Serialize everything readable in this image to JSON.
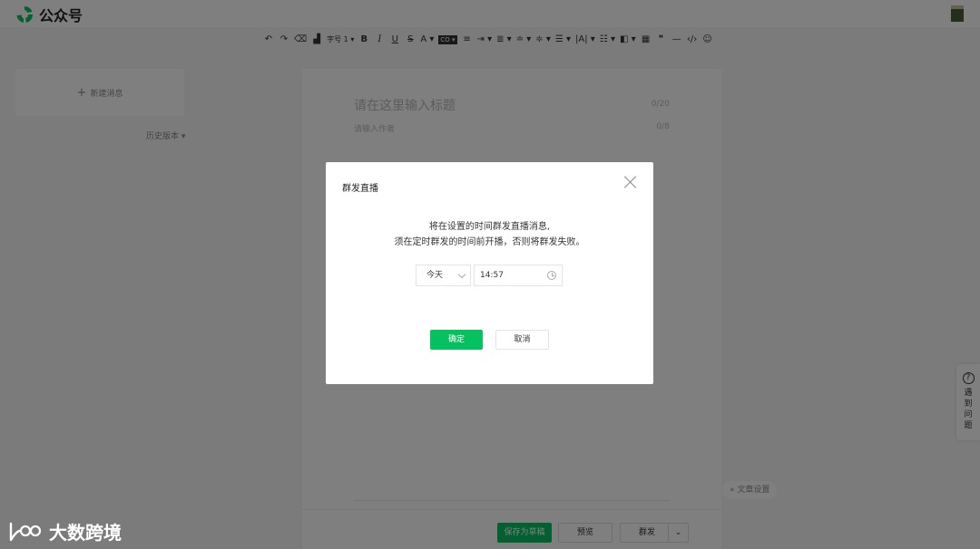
{
  "app": {
    "name": "公众号"
  },
  "toolbar": {
    "items": [
      {
        "name": "undo-icon",
        "glyph": "↶"
      },
      {
        "name": "redo-icon",
        "glyph": "↷"
      },
      {
        "name": "format-paint-icon",
        "glyph": "⌫"
      },
      {
        "name": "clear-format-icon",
        "glyph": "▟"
      },
      {
        "name": "font-size-select",
        "glyph": "字号 1 ▾"
      },
      {
        "name": "bold-button",
        "glyph": "B"
      },
      {
        "name": "italic-button",
        "glyph": "I"
      },
      {
        "name": "underline-button",
        "glyph": "U"
      },
      {
        "name": "strikethrough-button",
        "glyph": "S"
      },
      {
        "name": "font-color-button",
        "glyph": "A ▾"
      },
      {
        "name": "background-color-button",
        "glyph": "CO ▾"
      },
      {
        "name": "align-left-icon",
        "glyph": "≡"
      },
      {
        "name": "indent-icon",
        "glyph": "⇥ ▾"
      },
      {
        "name": "align-center-icon",
        "glyph": "≣ ▾"
      },
      {
        "name": "line-height-icon",
        "glyph": "≐ ▾"
      },
      {
        "name": "paragraph-spacing-icon",
        "glyph": "≑ ▾"
      },
      {
        "name": "list-icon",
        "glyph": "☰ ▾"
      },
      {
        "name": "letter-spacing-icon",
        "glyph": "|A| ▾"
      },
      {
        "name": "bullet-list-icon",
        "glyph": "☷ ▾"
      },
      {
        "name": "border-icon",
        "glyph": "◧ ▾"
      },
      {
        "name": "table-icon",
        "glyph": "▦"
      },
      {
        "name": "quote-icon",
        "glyph": "❞"
      },
      {
        "name": "divider-icon",
        "glyph": "—"
      },
      {
        "name": "code-icon",
        "glyph": "‹/›"
      },
      {
        "name": "emoji-icon",
        "glyph": "☺"
      }
    ]
  },
  "sidebar": {
    "new_message": "新建消息",
    "history": "历史版本 ▾"
  },
  "editor": {
    "title_placeholder": "请在这里输入标题",
    "title_count": "0/20",
    "author_placeholder": "请输入作者",
    "author_count": "0/8"
  },
  "article_settings": "文章设置",
  "help": {
    "label": "遇到问题"
  },
  "bottom": {
    "save": "保存为草稿",
    "preview": "预览",
    "send": "群发"
  },
  "dialog": {
    "title": "群发直播",
    "message_line1": "将在设置的时间群发直播消息,",
    "message_line2": "须在定时群发的时间前开播，否则将群发失败。",
    "day_select": "今天",
    "time_value": "14:57",
    "confirm": "确定",
    "cancel": "取消"
  },
  "watermark": {
    "text": "大数跨境"
  },
  "colors": {
    "primary": "#07c160",
    "overlay": "rgba(0,0,0,0.5)"
  }
}
